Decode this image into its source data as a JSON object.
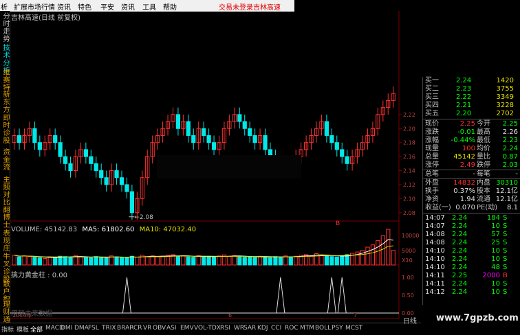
{
  "menu": {
    "items": [
      "析",
      "扩展市场行情",
      "资讯",
      "特色",
      "平安",
      "资讯",
      "工具",
      "帮助"
    ],
    "status_login": "交易未登录",
    "status_stock": "吉林高速"
  },
  "left_strip": [
    {
      "text": "分时走势",
      "color": "#c0c0c0"
    },
    {
      "text": "技术分析",
      "color": "#00e0e0"
    },
    {
      "text": "维赛特",
      "color": "#e0a000"
    },
    {
      "text": "新东方",
      "color": "#e0a000"
    },
    {
      "text": "即时诊股",
      "color": "#e0a000"
    },
    {
      "text": "资金流",
      "color": "#e0a000"
    },
    {
      "text": "主题对比",
      "color": "#e0a000"
    },
    {
      "text": "翻博士",
      "color": "#e0a000"
    },
    {
      "text": "表现庄",
      "color": "#e0a000"
    },
    {
      "text": "牛叉诊股",
      "color": "#e0a000"
    },
    {
      "text": "散户积",
      "color": "#e0a000"
    },
    {
      "text": "理财通",
      "color": "#e0a000"
    }
  ],
  "chart_title": "吉林高速(日线 前复权)",
  "volume_line": {
    "label": "VOLUME: 45142.83",
    "ma5": "MA5: 61802.60",
    "ma10": "MA10: 47032.40"
  },
  "indicator_line": "擒力黄金柱 : 0.00",
  "dim_text": "用到未来数据",
  "year_label": "2014年",
  "low_annotation": "2.08",
  "month_labels": [
    "6",
    "7"
  ],
  "right_axis_price": [
    "2.22",
    "2.20",
    "2.18",
    "2.16",
    "2.14",
    "2.12",
    "2.10",
    "2.08"
  ],
  "right_axis_volume": [
    "10000",
    "5000",
    "X10"
  ],
  "right_axis_indicator": [
    "1.00",
    "0.50",
    "0.00"
  ],
  "marker_b": "B",
  "tabs": [
    "指标",
    "模板",
    "全部",
    "MACD",
    "DMI",
    "DMA",
    "FSL",
    "TRIX",
    "BRAR",
    "CR",
    "VR",
    "OBV",
    "ASI",
    "EMV",
    "VOL-TDX",
    "RSI",
    "WR",
    "SAR",
    "KDJ",
    "CCI",
    "ROC",
    "MTM",
    "BOLL",
    "PSY",
    "MCST"
  ],
  "day_label": "日线",
  "bid_rows": [
    {
      "label": "买一",
      "price": "2.24",
      "vol": "1420"
    },
    {
      "label": "买二",
      "price": "2.23",
      "vol": "3755"
    },
    {
      "label": "买三",
      "price": "2.22",
      "vol": "3349"
    },
    {
      "label": "买四",
      "price": "2.21",
      "vol": "3228"
    },
    {
      "label": "买五",
      "price": "2.20",
      "vol": "2702"
    }
  ],
  "quote_rows": [
    {
      "l1": "现价",
      "v1": "2.25",
      "c1": "#ff3030",
      "l2": "今开",
      "v2": "2.25",
      "c2": "#00ff00"
    },
    {
      "l1": "涨跌",
      "v1": "-0.01",
      "c1": "#00ff00",
      "l2": "最高",
      "v2": "2.26",
      "c2": "#e0e0e0"
    },
    {
      "l1": "涨幅",
      "v1": "-0.44%",
      "c1": "#00ff00",
      "l2": "最低",
      "v2": "2.23",
      "c2": "#00ff00"
    },
    {
      "l1": "现量",
      "v1": "100",
      "c1": "#ff3030",
      "l2": "均价",
      "v2": "2.24",
      "c2": "#00ff00"
    },
    {
      "l1": "总量",
      "v1": "45142",
      "c1": "#e0e000",
      "l2": "量比",
      "v2": "0.87",
      "c2": "#00ff00"
    },
    {
      "l1": "涨停",
      "v1": "2.49",
      "c1": "#ff3030",
      "l2": "跌停",
      "v2": "2.03",
      "c2": "#00ff00"
    },
    {
      "l1": "总笔",
      "v1": "-",
      "c1": "#c0c0c0",
      "l2": "每笔",
      "v2": "-",
      "c2": "#c0c0c0"
    },
    {
      "l1": "外盘",
      "v1": "14832",
      "c1": "#ff3030",
      "l2": "内盘",
      "v2": "30310",
      "c2": "#00ff00"
    },
    {
      "l1": "换手",
      "v1": "0.37%",
      "c1": "#e0e0e0",
      "l2": "股本",
      "v2": "12.1亿",
      "c2": "#e0e0e0"
    },
    {
      "l1": "净资",
      "v1": "1.94",
      "c1": "#e0e0e0",
      "l2": "流通",
      "v2": "12.1亿",
      "c2": "#e0e0e0"
    },
    {
      "l1": "收益(一)",
      "v1": "0.070",
      "c1": "#e0e0e0",
      "l2": "PE(动)",
      "v2": "8.1",
      "c2": "#e0e0e0"
    }
  ],
  "ticks": [
    {
      "time": "14:07",
      "price": "2.24",
      "vol": "184",
      "side": "S",
      "pc": "#00ff00",
      "vc": "#00ff00",
      "sc": "#00ff00"
    },
    {
      "time": "14:07",
      "price": "2.24",
      "vol": "10",
      "side": "S",
      "pc": "#00ff00",
      "vc": "#00ff00",
      "sc": "#00ff00"
    },
    {
      "time": "14:08",
      "price": "2.24",
      "vol": "57",
      "side": "S",
      "pc": "#00ff00",
      "vc": "#00ff00",
      "sc": "#00ff00"
    },
    {
      "time": "14:08",
      "price": "2.24",
      "vol": "25",
      "side": "S",
      "pc": "#00ff00",
      "vc": "#00ff00",
      "sc": "#00ff00"
    },
    {
      "time": "14:10",
      "price": "2.24",
      "vol": "10",
      "side": "S",
      "pc": "#00ff00",
      "vc": "#00ff00",
      "sc": "#00ff00"
    },
    {
      "time": "14:10",
      "price": "2.24",
      "vol": "10",
      "side": "S",
      "pc": "#00ff00",
      "vc": "#00ff00",
      "sc": "#00ff00"
    },
    {
      "time": "14:10",
      "price": "2.24",
      "vol": "48",
      "side": "S",
      "pc": "#00ff00",
      "vc": "#00ff00",
      "sc": "#00ff00"
    },
    {
      "time": "14:11",
      "price": "2.25",
      "vol": "2000",
      "side": "B",
      "pc": "#00ff00",
      "vc": "#ff00ff",
      "sc": "#ff3030"
    },
    {
      "time": "14:11",
      "price": "2.24",
      "vol": "10",
      "side": "S",
      "pc": "#00ff00",
      "vc": "#00ff00",
      "sc": "#00ff00"
    },
    {
      "time": "14:12",
      "price": "2.24",
      "vol": "10",
      "side": "S",
      "pc": "#00ff00",
      "vc": "#00ff00",
      "sc": "#00ff00"
    }
  ],
  "watermark": "www.7gpzb.com",
  "colors": {
    "up_candle": "#ff3030",
    "down_candle": "#00e8e8",
    "ma5": "#ffffff",
    "ma10": "#e0e000",
    "grid": "#7a0000",
    "axis_text": "#c04040"
  },
  "chart_data": {
    "type": "candlestick",
    "title": "吉林高速(日线 前复权)",
    "candles_close_est": [
      2.19,
      2.18,
      2.19,
      2.2,
      2.18,
      2.17,
      2.18,
      2.19,
      2.18,
      2.16,
      2.15,
      2.14,
      2.16,
      2.17,
      2.16,
      2.15,
      2.14,
      2.13,
      2.12,
      2.14,
      2.13,
      2.12,
      2.11,
      2.08,
      2.1,
      2.13,
      2.16,
      2.18,
      2.19,
      2.2,
      2.21,
      2.22,
      2.2,
      2.21,
      2.19,
      2.18,
      2.2,
      2.19,
      2.18,
      2.17,
      2.18,
      2.2,
      2.21,
      2.22,
      2.21,
      2.2,
      2.19,
      2.18,
      2.19,
      2.17,
      2.16,
      2.15,
      2.14,
      2.15,
      2.14,
      2.16,
      2.17,
      2.18,
      2.19,
      2.2,
      2.21,
      2.19,
      2.18,
      2.17,
      2.16,
      2.15,
      2.16,
      2.17,
      2.18,
      2.19,
      2.2,
      2.22,
      2.23,
      2.24,
      2.25
    ],
    "candles_up": [
      1,
      0,
      1,
      1,
      0,
      0,
      1,
      1,
      0,
      0,
      0,
      0,
      1,
      1,
      0,
      0,
      0,
      0,
      0,
      1,
      0,
      0,
      0,
      0,
      1,
      1,
      1,
      1,
      1,
      1,
      1,
      1,
      0,
      1,
      0,
      0,
      1,
      0,
      0,
      0,
      1,
      1,
      1,
      1,
      0,
      0,
      0,
      0,
      1,
      0,
      0,
      0,
      0,
      1,
      0,
      1,
      1,
      1,
      1,
      1,
      1,
      0,
      0,
      0,
      0,
      0,
      1,
      1,
      1,
      1,
      1,
      1,
      1,
      1,
      1
    ],
    "volumes_est": [
      30000,
      25000,
      28000,
      26000,
      24000,
      22000,
      20000,
      25000,
      23000,
      27000,
      26000,
      24000,
      29000,
      25000,
      23000,
      22000,
      26000,
      24000,
      21000,
      28000,
      25000,
      23000,
      22000,
      27000,
      24000,
      30000,
      26000,
      28000,
      25000,
      27000,
      30000,
      32000,
      26000,
      28000,
      25000,
      24000,
      29000,
      26000,
      25000,
      24000,
      28000,
      31000,
      27000,
      29000,
      25000,
      24000,
      26000,
      23000,
      27000,
      25000,
      22000,
      26000,
      24000,
      28000,
      25000,
      27000,
      30000,
      32000,
      29000,
      35000,
      30000,
      27000,
      26000,
      25000,
      29000,
      32000,
      36000,
      40000,
      45000,
      55000,
      62000,
      75000,
      90000,
      110000,
      45142
    ],
    "signal_peaks_at": [
      22,
      52,
      62,
      64
    ],
    "price_axis": {
      "ticks": [
        2.08,
        2.1,
        2.12,
        2.14,
        2.16,
        2.18,
        2.2,
        2.22
      ]
    },
    "volume_axis": {
      "ticks": [
        5000,
        10000
      ],
      "multiplier": "X10"
    },
    "indicator_axis": {
      "ticks": [
        0.0,
        0.5,
        1.0
      ]
    },
    "low_label": 2.08
  }
}
